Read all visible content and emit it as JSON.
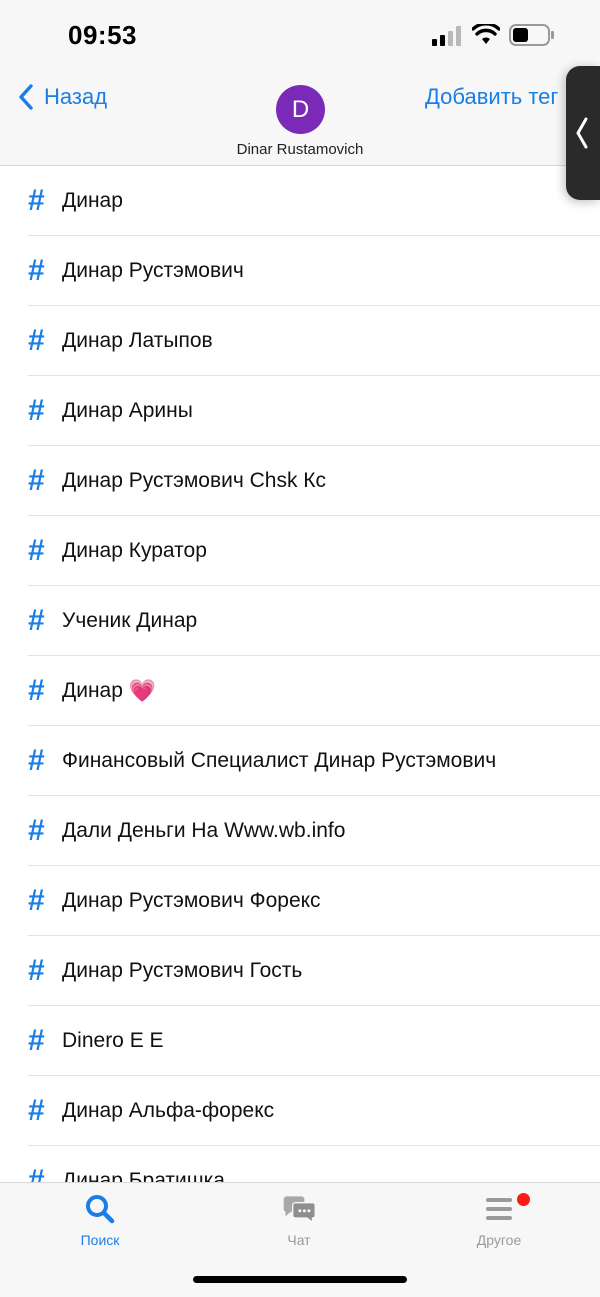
{
  "status_bar": {
    "time": "09:53"
  },
  "nav": {
    "back_label": "Назад",
    "avatar_letter": "D",
    "contact_name": "Dinar Rustamovich",
    "add_tag_label": "Добавить тег"
  },
  "tags": [
    "Динар",
    "Динар Рустэмович",
    "Динар Латыпов",
    "Динар Арины",
    "Динар Рустэмович Chsk Кс",
    "Динар Куратор",
    "Ученик Динар",
    "Динар",
    "Финансовый Специалист Динар Рустэмович",
    "Дали Деньги На Www.wb.info",
    "Динар Рустэмович Форекс",
    "Динар Рустэмович Гость",
    "Dinero E E",
    "Динар Альфа-форекс",
    "Динар Братишка"
  ],
  "heart_emoji": "💗",
  "tabs": {
    "search": "Поиск",
    "chat": "Чат",
    "other": "Другое"
  },
  "colors": {
    "accent": "#1a7ee6",
    "avatar": "#7b2ab8",
    "badge": "#ff1a1a"
  }
}
